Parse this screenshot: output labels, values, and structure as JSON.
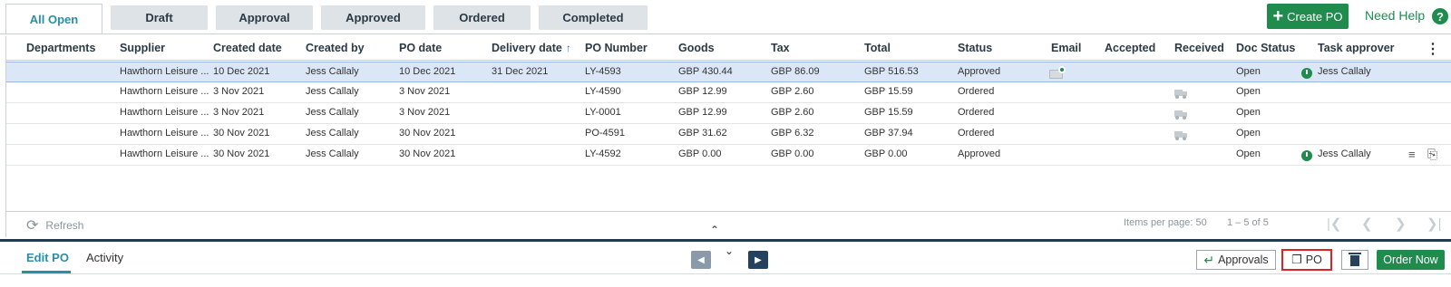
{
  "tabs": [
    {
      "label": "All Open",
      "active": true
    },
    {
      "label": "Draft"
    },
    {
      "label": "Approval"
    },
    {
      "label": "Approved"
    },
    {
      "label": "Ordered"
    },
    {
      "label": "Completed"
    }
  ],
  "header": {
    "create_po_label": "Create PO",
    "create_po_icon": "plus-icon",
    "help_label": "Need Help",
    "help_icon": "question-icon"
  },
  "table": {
    "columns": [
      "Departments",
      "Supplier",
      "Created date",
      "Created by",
      "PO date",
      "Delivery date",
      "PO Number",
      "Goods",
      "Tax",
      "Total",
      "Status",
      "Email",
      "Accepted",
      "Received",
      "Doc Status",
      "Task approver"
    ],
    "sorted_column": "Delivery date",
    "sort_direction": "ascending",
    "rows": [
      {
        "selected": true,
        "department": "",
        "supplier": "Hawthorn Leisure ...",
        "created_date": "10 Dec 2021",
        "created_by": "Jess Callaly",
        "po_date": "10 Dec 2021",
        "delivery_date": "31 Dec 2021",
        "po_number": "LY-4593",
        "goods": "GBP 430.44",
        "tax": "GBP 86.09",
        "total": "GBP 516.53",
        "status": "Approved",
        "email": true,
        "accepted": "",
        "received": false,
        "doc_status": "Open",
        "approver_clock": true,
        "task_approver": "Jess Callaly",
        "notes": false,
        "attachment": false
      },
      {
        "selected": false,
        "department": "",
        "supplier": "Hawthorn Leisure ...",
        "created_date": "3 Nov 2021",
        "created_by": "Jess Callaly",
        "po_date": "3 Nov 2021",
        "delivery_date": "",
        "po_number": "LY-4590",
        "goods": "GBP 12.99",
        "tax": "GBP 2.60",
        "total": "GBP 15.59",
        "status": "Ordered",
        "email": false,
        "accepted": "",
        "received": true,
        "doc_status": "Open",
        "approver_clock": false,
        "task_approver": "",
        "notes": false,
        "attachment": false
      },
      {
        "selected": false,
        "department": "",
        "supplier": "Hawthorn Leisure ...",
        "created_date": "3 Nov 2021",
        "created_by": "Jess Callaly",
        "po_date": "3 Nov 2021",
        "delivery_date": "",
        "po_number": "LY-0001",
        "goods": "GBP 12.99",
        "tax": "GBP 2.60",
        "total": "GBP 15.59",
        "status": "Ordered",
        "email": false,
        "accepted": "",
        "received": true,
        "doc_status": "Open",
        "approver_clock": false,
        "task_approver": "",
        "notes": false,
        "attachment": false
      },
      {
        "selected": false,
        "department": "",
        "supplier": "Hawthorn Leisure ...",
        "created_date": "30 Nov 2021",
        "created_by": "Jess Callaly",
        "po_date": "30 Nov 2021",
        "delivery_date": "",
        "po_number": "PO-4591",
        "goods": "GBP 31.62",
        "tax": "GBP 6.32",
        "total": "GBP 37.94",
        "status": "Ordered",
        "email": false,
        "accepted": "",
        "received": true,
        "doc_status": "Open",
        "approver_clock": false,
        "task_approver": "",
        "notes": false,
        "attachment": false
      },
      {
        "selected": false,
        "department": "",
        "supplier": "Hawthorn Leisure ...",
        "created_date": "30 Nov 2021",
        "created_by": "Jess Callaly",
        "po_date": "30 Nov 2021",
        "delivery_date": "",
        "po_number": "LY-4592",
        "goods": "GBP 0.00",
        "tax": "GBP 0.00",
        "total": "GBP 0.00",
        "status": "Approved",
        "email": false,
        "accepted": "",
        "received": false,
        "doc_status": "Open",
        "approver_clock": true,
        "task_approver": "Jess Callaly",
        "notes": true,
        "attachment": true
      }
    ]
  },
  "footer": {
    "refresh_label": "Refresh",
    "items_per_page": "Items per page: 50",
    "range": "1 – 5 of 5"
  },
  "bottom": {
    "tabs": [
      "Edit PO",
      "Activity"
    ],
    "active_tab": "Edit PO",
    "approvals_label": "Approvals",
    "po_label": "PO",
    "order_now_label": "Order Now"
  },
  "colors": {
    "accent": "#2a8fa6",
    "primary_green": "#1f8c4e",
    "selected_row": "#dbe6f7",
    "divider_navy": "#1f3a52",
    "highlight_red": "#e22222"
  }
}
